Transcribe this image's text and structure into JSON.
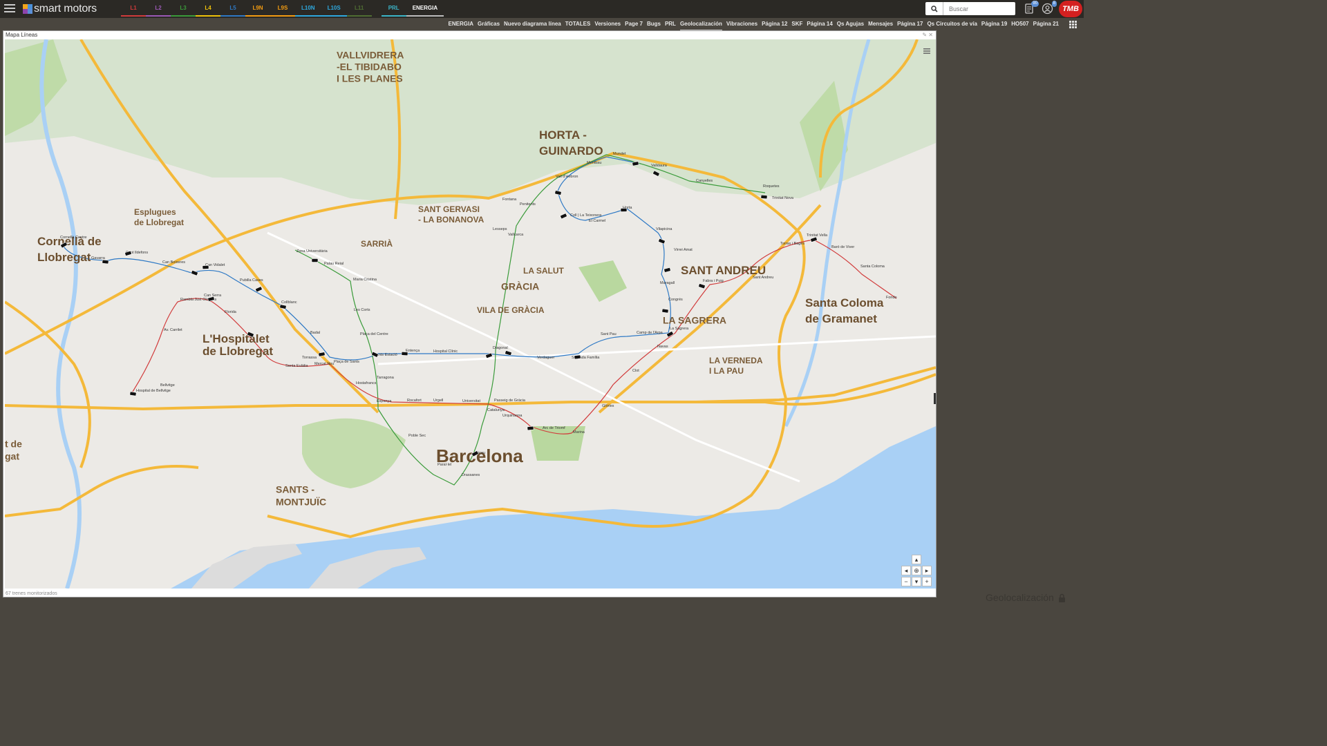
{
  "header": {
    "app_name": "smart motors",
    "line_tabs": [
      {
        "label": "L1",
        "color": "#d13b3b"
      },
      {
        "label": "L2",
        "color": "#9b59b6"
      },
      {
        "label": "L3",
        "color": "#3a9b3a"
      },
      {
        "label": "L4",
        "color": "#f0c20a"
      },
      {
        "label": "L5",
        "color": "#2e79c5"
      },
      {
        "label": "L9N",
        "color": "#f39c12"
      },
      {
        "label": "L9S",
        "color": "#f39c12"
      },
      {
        "label": "L10N",
        "color": "#2ea9df"
      },
      {
        "label": "L10S",
        "color": "#2ea9df"
      },
      {
        "label": "L11",
        "color": "#7bc043"
      },
      {
        "label": "PRL",
        "color": "#3bb5c9"
      },
      {
        "label": "ENERGIA",
        "color": "#ffffff"
      }
    ],
    "search_placeholder": "Buscar",
    "notif_badge_1": "90",
    "notif_badge_2": "8",
    "brand_logo": "TMB"
  },
  "page_tabs": [
    "ENERGIA",
    "Gráficas",
    "Nuevo diagrama línea",
    "TOTALES",
    "Versiones",
    "Page 7",
    "Bugs",
    "PRL",
    "Geolocalización",
    "Vibraciones",
    "Página 12",
    "SKF",
    "Página 14",
    "Qs Agujas",
    "Mensajes",
    "Página 17",
    "Qs Circuitos de vía",
    "Página 19",
    "HO507",
    "Página 21"
  ],
  "active_page_tab": "Geolocalización",
  "panel": {
    "title": "Mapa Líneas",
    "status": "67 trenes monitorizados"
  },
  "watermark": "Geolocalización",
  "map": {
    "districts": [
      {
        "text": "VALLVIDRERA",
        "size": "big"
      },
      {
        "text": "-EL TIBIDABO",
        "size": "big"
      },
      {
        "text": "I LES PLANES",
        "size": "big"
      },
      {
        "text": "HORTA -",
        "size": "xl"
      },
      {
        "text": "GUINARDO",
        "size": "xl"
      },
      {
        "text": "SANT GERVASI",
        "size": "mid"
      },
      {
        "text": "- LA BONANOVA",
        "size": "mid"
      },
      {
        "text": "Esplugues",
        "size": "mid"
      },
      {
        "text": "de Llobregat",
        "size": "mid"
      },
      {
        "text": "Cornellà de",
        "size": "xl"
      },
      {
        "text": "Llobregat",
        "size": "xl"
      },
      {
        "text": "SARRIÀ",
        "size": "mid"
      },
      {
        "text": "LA SALUT",
        "size": "mid"
      },
      {
        "text": "GRÀCIA",
        "size": "big"
      },
      {
        "text": "VILA DE GRÀCIA",
        "size": "mid"
      },
      {
        "text": "SANT ANDREU",
        "size": "xl"
      },
      {
        "text": "LA SAGRERA",
        "size": "big"
      },
      {
        "text": "Santa Coloma",
        "size": "xl"
      },
      {
        "text": "de Gramanet",
        "size": "xl"
      },
      {
        "text": "LA VERNEDA",
        "size": "mid"
      },
      {
        "text": "I LA PAU",
        "size": "mid"
      },
      {
        "text": "L'Hospitalet",
        "size": "xl"
      },
      {
        "text": "de Llobregat",
        "size": "xl"
      },
      {
        "text": "Barcelona",
        "size": "xxl"
      },
      {
        "text": "SANTS -",
        "size": "big"
      },
      {
        "text": "MONTJUÏC",
        "size": "big"
      },
      {
        "text": "t de",
        "size": "big"
      },
      {
        "text": "gat",
        "size": "big"
      }
    ],
    "stations": [
      "Cornellà Centre",
      "Gavarra",
      "Sant Ildefons",
      "Can Boixeres",
      "Can Vidalet",
      "Pubilla Cases",
      "Collblanc",
      "Badal",
      "Plaça de Sants",
      "Sants Estació",
      "Entença",
      "Hospital Clínic",
      "Diagonal",
      "Verdaguer",
      "Sagrada Família",
      "Sant Pau",
      "Camp de l'Arpa",
      "La Sagrera",
      "Congrés",
      "Maragall",
      "Virrei Amat",
      "Vilapicina",
      "Horta",
      "El Carmel",
      "Coll | La Teixonera",
      "Vall d'Hebron",
      "Montbau",
      "Mundet",
      "Valldaura",
      "Canyelles",
      "Roquetes",
      "Trinitat Nova",
      "Penitents",
      "Vallcarca",
      "Lesseps",
      "Fontana",
      "Zona Universitària",
      "Palau Reial",
      "Maria Cristina",
      "Les Corts",
      "Plaça del Centre",
      "Tarragona",
      "Hostafrancs",
      "Mercat Nou",
      "Santa Eulàlia",
      "Torrassa",
      "Florida",
      "Can Serra",
      "Rambla Just Oliveras",
      "Av. Carrilet",
      "Bellvitge",
      "Hospital de Bellvitge",
      "Espanya",
      "Rocafort",
      "Urgell",
      "Universitat",
      "Passeig de Gràcia",
      "Catalunya",
      "Urquinaona",
      "Arc de Triomf",
      "Marina",
      "Glòries",
      "Clot",
      "Navas",
      "Fabra i Puig",
      "Sant Andreu",
      "Torras i Bages",
      "Trinitat Vella",
      "Baró de Viver",
      "Santa Coloma",
      "Fondo",
      "Poble Sec",
      "Paral·lel",
      "Drassanes",
      "Liceu"
    ]
  }
}
